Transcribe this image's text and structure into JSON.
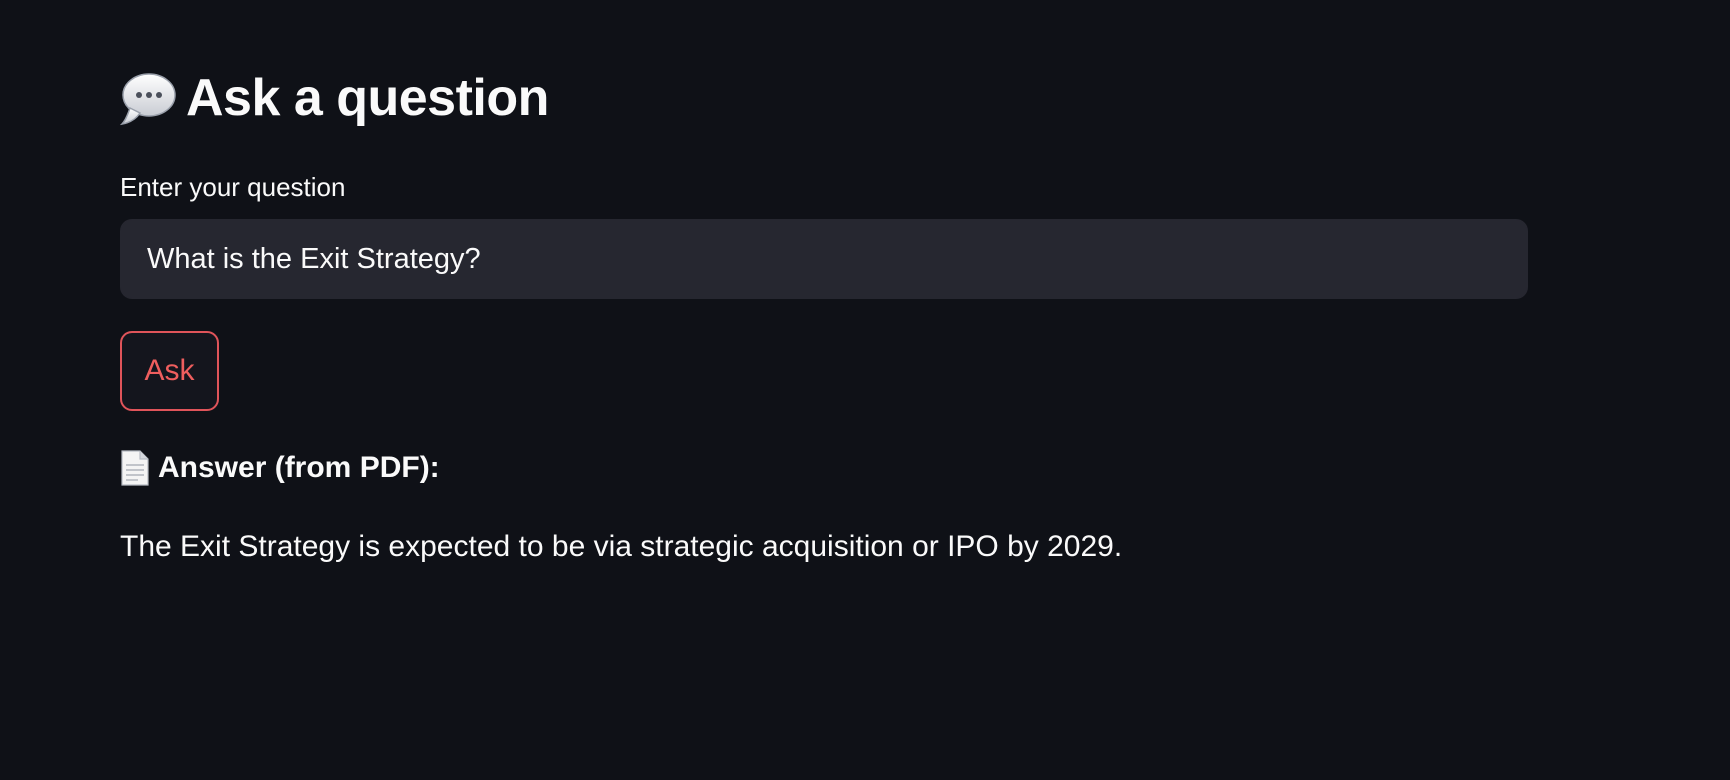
{
  "header": {
    "title_icon": "speech-balloon-icon",
    "title": "Ask a question"
  },
  "question_form": {
    "label": "Enter your question",
    "value": "What is the Exit Strategy?",
    "button_label": "Ask"
  },
  "answer": {
    "heading_icon": "page-facing-up-icon",
    "heading": "Answer (from PDF):",
    "text": "The Exit Strategy is expected to be via strategic acquisition or IPO by 2029."
  },
  "colors": {
    "background": "#0f1117",
    "input_background": "#262730",
    "accent": "#ef5e5e",
    "text": "#fafafa"
  }
}
